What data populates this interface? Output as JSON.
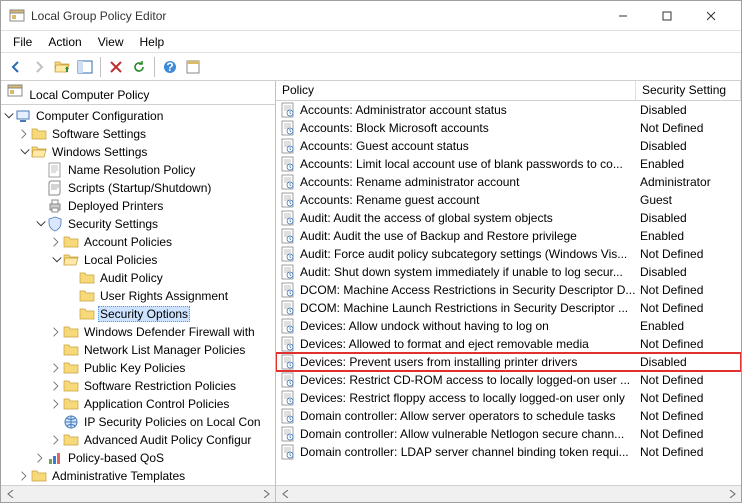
{
  "window": {
    "title": "Local Group Policy Editor"
  },
  "menu": {
    "file": "File",
    "action": "Action",
    "view": "View",
    "help": "Help"
  },
  "tree": {
    "heading": "Local Computer Policy",
    "root": "Computer Configuration",
    "software": "Software Settings",
    "windows": "Windows Settings",
    "nrp": "Name Resolution Policy",
    "scripts": "Scripts (Startup/Shutdown)",
    "printers": "Deployed Printers",
    "security": "Security Settings",
    "account_policies": "Account Policies",
    "local_policies": "Local Policies",
    "audit_policy": "Audit Policy",
    "user_rights": "User Rights Assignment",
    "security_options": "Security Options",
    "firewall": "Windows Defender Firewall with",
    "netlist": "Network List Manager Policies",
    "pkp": "Public Key Policies",
    "srp": "Software Restriction Policies",
    "acp": "Application Control Policies",
    "ipsec": "IP Security Policies on Local Con",
    "aapc": "Advanced Audit Policy Configur",
    "qos": "Policy-based QoS",
    "admin_templates": "Administrative Templates"
  },
  "columns": {
    "policy": "Policy",
    "setting": "Security Setting"
  },
  "policies": [
    {
      "name": "Accounts: Administrator account status",
      "setting": "Disabled",
      "hl": false
    },
    {
      "name": "Accounts: Block Microsoft accounts",
      "setting": "Not Defined",
      "hl": false
    },
    {
      "name": "Accounts: Guest account status",
      "setting": "Disabled",
      "hl": false
    },
    {
      "name": "Accounts: Limit local account use of blank passwords to co...",
      "setting": "Enabled",
      "hl": false
    },
    {
      "name": "Accounts: Rename administrator account",
      "setting": "Administrator",
      "hl": false
    },
    {
      "name": "Accounts: Rename guest account",
      "setting": "Guest",
      "hl": false
    },
    {
      "name": "Audit: Audit the access of global system objects",
      "setting": "Disabled",
      "hl": false
    },
    {
      "name": "Audit: Audit the use of Backup and Restore privilege",
      "setting": "Enabled",
      "hl": false
    },
    {
      "name": "Audit: Force audit policy subcategory settings (Windows Vis...",
      "setting": "Not Defined",
      "hl": false
    },
    {
      "name": "Audit: Shut down system immediately if unable to log secur...",
      "setting": "Disabled",
      "hl": false
    },
    {
      "name": "DCOM: Machine Access Restrictions in Security Descriptor D...",
      "setting": "Not Defined",
      "hl": false
    },
    {
      "name": "DCOM: Machine Launch Restrictions in Security Descriptor ...",
      "setting": "Not Defined",
      "hl": false
    },
    {
      "name": "Devices: Allow undock without having to log on",
      "setting": "Enabled",
      "hl": false
    },
    {
      "name": "Devices: Allowed to format and eject removable media",
      "setting": "Not Defined",
      "hl": false
    },
    {
      "name": "Devices: Prevent users from installing printer drivers",
      "setting": "Disabled",
      "hl": true
    },
    {
      "name": "Devices: Restrict CD-ROM access to locally logged-on user ...",
      "setting": "Not Defined",
      "hl": false
    },
    {
      "name": "Devices: Restrict floppy access to locally logged-on user only",
      "setting": "Not Defined",
      "hl": false
    },
    {
      "name": "Domain controller: Allow server operators to schedule tasks",
      "setting": "Not Defined",
      "hl": false
    },
    {
      "name": "Domain controller: Allow vulnerable Netlogon secure chann...",
      "setting": "Not Defined",
      "hl": false
    },
    {
      "name": "Domain controller: LDAP server channel binding token requi...",
      "setting": "Not Defined",
      "hl": false
    }
  ]
}
